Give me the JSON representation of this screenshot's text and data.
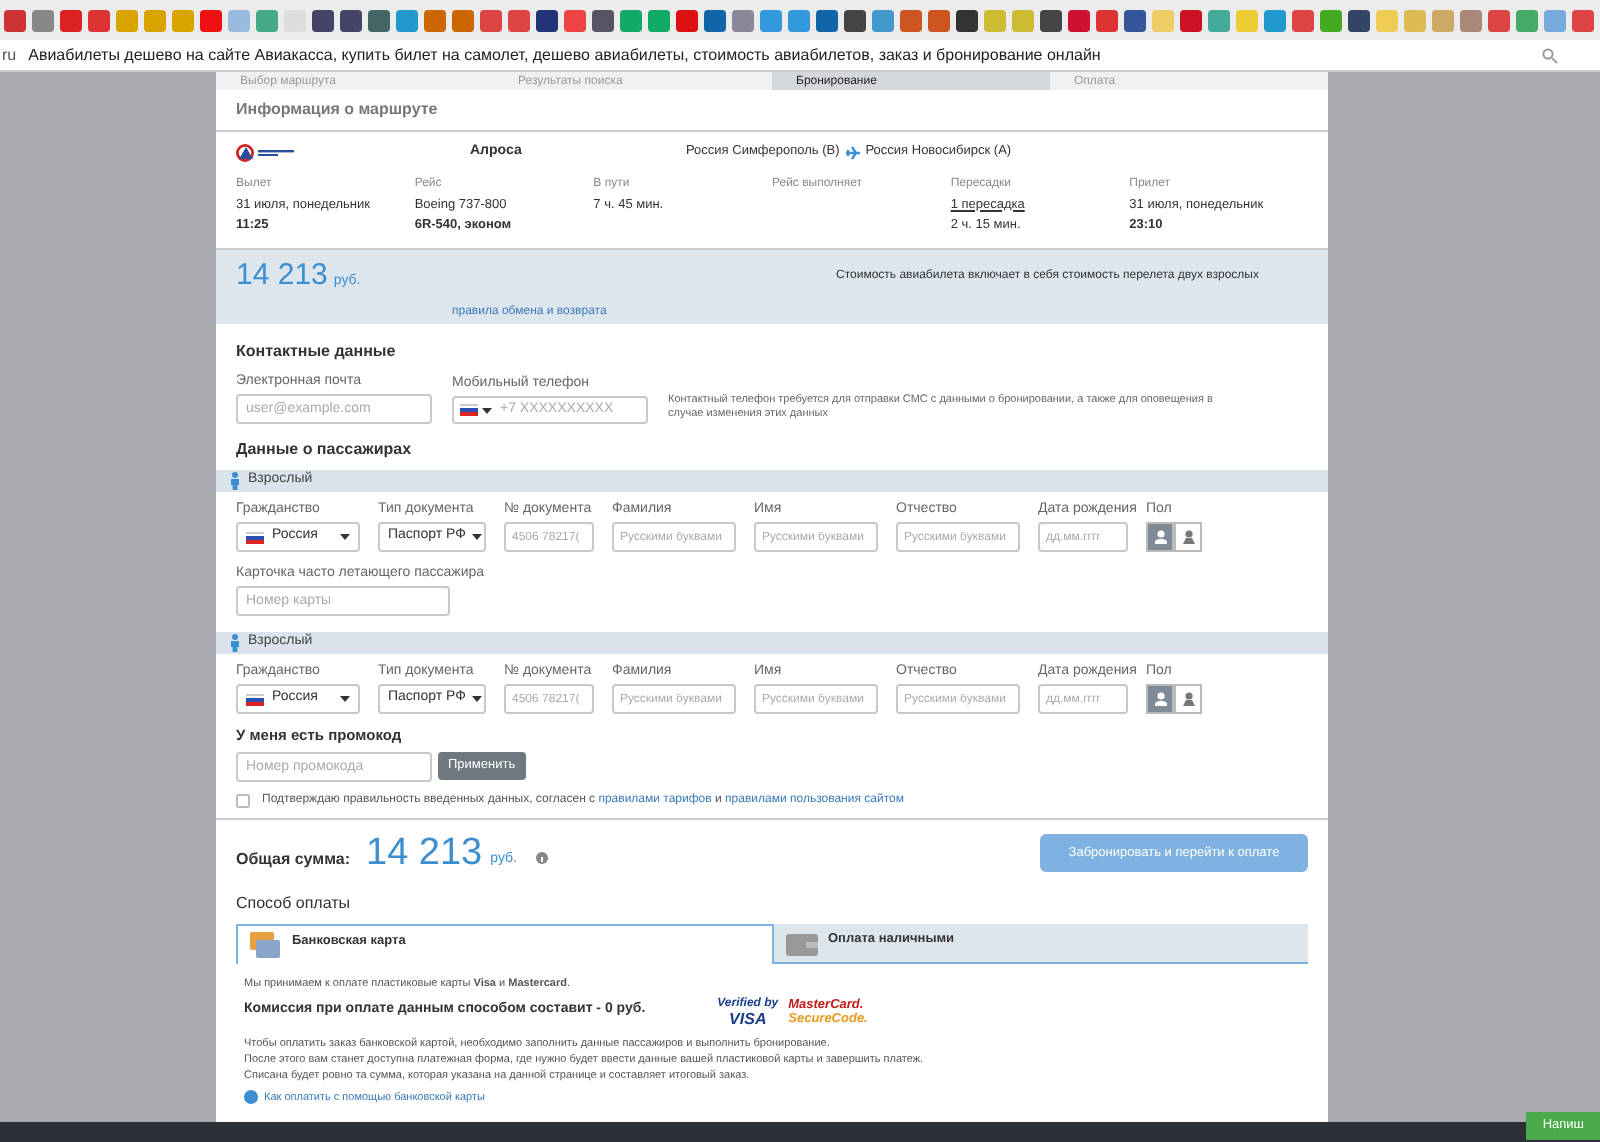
{
  "address_bar": {
    "url_prefix": "ru",
    "page_title": "Авиабилеты дешево на сайте Авиакасса, купить билет на самолет, дешево авиабилеты, стоимость авиабилетов, заказ и бронирование онлайн"
  },
  "steps": [
    {
      "label": "Выбор маршрута",
      "selected": false
    },
    {
      "label": "Результаты поиска",
      "selected": false
    },
    {
      "label": "Бронирование",
      "selected": true
    },
    {
      "label": "Оплата",
      "selected": false
    }
  ],
  "route": {
    "title": "Информация о маршруте",
    "airline": "Алроса",
    "from": "Россия Симферополь (B)",
    "to": "Россия Новосибирск (A)",
    "details": [
      {
        "label": "Вылет",
        "lines": [
          {
            "text": "31 июля, понедельник",
            "kind": "plain"
          },
          {
            "text": "11:25",
            "kind": "bold"
          }
        ]
      },
      {
        "label": "Рейс",
        "lines": [
          {
            "text": "Boeing 737-800",
            "kind": "plain"
          },
          {
            "text": "6R-540, эконом",
            "kind": "bold"
          }
        ]
      },
      {
        "label": "В пути",
        "lines": [
          {
            "text": "7 ч. 45 мин.",
            "kind": "plain"
          }
        ]
      },
      {
        "label": "Рейс выполняет"
      },
      {
        "label": "Пересадки",
        "lines": [
          {
            "text": "1 пересадка",
            "kind": "link"
          },
          {
            "text": "2 ч. 15 мин.",
            "kind": "plain"
          }
        ]
      },
      {
        "label": "Прилет",
        "lines": [
          {
            "text": "31 июля, понедельник",
            "kind": "plain"
          },
          {
            "text": "23:10",
            "kind": "bold"
          }
        ]
      }
    ]
  },
  "price": {
    "amount": "14 213",
    "currency": "руб.",
    "rules_link": "правила обмена и возврата",
    "note": "Стоимость авиабилета включает в себя стоимость перелета двух взрослых"
  },
  "contacts": {
    "title": "Контактные данные",
    "email": {
      "label": "Электронная почта",
      "placeholder": "user@example.com"
    },
    "phone": {
      "label": "Мобильный телефон",
      "placeholder": "+7 XXXXXXXXXX"
    },
    "note": "Контактный телефон требуется для отправки СМС с данными о бронировании, а также для оповещения в случае изменения этих данных"
  },
  "passengers": {
    "title": "Данные о пассажирах",
    "list": [
      {
        "type_label": "Взрослый",
        "fields": [
          {
            "kind": "country",
            "label": "Гражданство",
            "value": "Россия"
          },
          {
            "kind": "select",
            "label": "Тип документа",
            "value": "Паспорт РФ"
          },
          {
            "kind": "input",
            "label": "№ документа",
            "placeholder": "4506 78217("
          },
          {
            "kind": "input",
            "label": "Фамилия",
            "placeholder": "Русскими буквами"
          },
          {
            "kind": "input",
            "label": "Имя",
            "placeholder": "Русскими буквами"
          },
          {
            "kind": "input",
            "label": "Отчество",
            "placeholder": "Русскими буквами"
          },
          {
            "kind": "input",
            "label": "Дата рождения",
            "placeholder": "дд.мм.гггг"
          },
          {
            "kind": "gender",
            "label": "Пол",
            "options": [
              {
                "selected": true
              },
              {
                "selected": false
              }
            ]
          }
        ],
        "card": {
          "label": "Карточка часто летающего пассажира",
          "placeholder": "Номер карты"
        }
      },
      {
        "type_label": "Взрослый",
        "fields": [
          {
            "kind": "country",
            "label": "Гражданство",
            "value": "Россия"
          },
          {
            "kind": "select",
            "label": "Тип документа",
            "value": "Паспорт РФ"
          },
          {
            "kind": "input",
            "label": "№ документа",
            "placeholder": "4506 78217("
          },
          {
            "kind": "input",
            "label": "Фамилия",
            "placeholder": "Русскими буквами"
          },
          {
            "kind": "input",
            "label": "Имя",
            "placeholder": "Русскими буквами"
          },
          {
            "kind": "input",
            "label": "Отчество",
            "placeholder": "Русскими буквами"
          },
          {
            "kind": "input",
            "label": "Дата рождения",
            "placeholder": "дд.мм.гггг"
          },
          {
            "kind": "gender",
            "label": "Пол",
            "options": [
              {
                "selected": true
              },
              {
                "selected": false
              }
            ]
          }
        ]
      }
    ]
  },
  "promo": {
    "title": "У меня есть промокод",
    "placeholder": "Номер промокода",
    "button": "Применить"
  },
  "agreement": {
    "checked": false,
    "text": "Подтверждаю правильность введенных данных, согласен с",
    "link_tariffs": "правилами тарифов",
    "joiner": "и",
    "link_site": "правилами пользования сайтом"
  },
  "total": {
    "label": "Общая сумма:",
    "amount": "14 213",
    "currency": "руб.",
    "button": "Забронировать и перейти к оплате"
  },
  "payment": {
    "title": "Способ оплаты",
    "tabs": [
      {
        "label": "Банковская карта",
        "kind": "card",
        "selected": true
      },
      {
        "label": "Оплата наличными",
        "kind": "cash",
        "selected": false
      }
    ],
    "accept_text": "Мы принимаем к оплате пластиковые карты **Visa** и **Mastercard**.",
    "commission": "Комиссия при оплате данным способом составит - 0 руб.",
    "logos": {
      "verified_top": "Verified by",
      "verified_bottom": "VISA",
      "mc_top": "MasterCard.",
      "mc_bottom": "SecureCode."
    },
    "instructions": [
      "Чтобы оплатить заказ банковской картой, необходимо заполнить данные пассажиров и выполнить бронирование.",
      "После этого вам станет доступна платежная форма, где нужно будет ввести данные вашей пластиковой карты и завершить платеж.",
      "Списана будет ровно та сумма, которая указана на данной странице и составляет итоговый заказ."
    ],
    "help_link": "Как оплатить с помощью банковской карты"
  },
  "chat_button": "Напиш"
}
